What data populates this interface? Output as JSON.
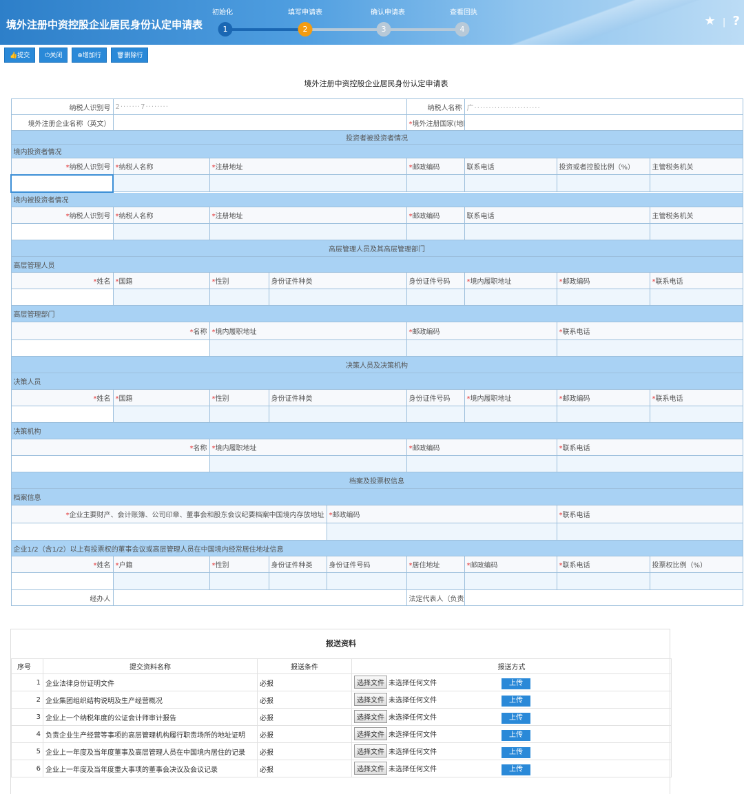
{
  "header": {
    "title": "境外注册中资控股企业居民身份认定申请表",
    "steps": [
      {
        "label": "初始化",
        "num": "1"
      },
      {
        "label": "填写申请表",
        "num": "2"
      },
      {
        "label": "确认申请表",
        "num": "3"
      },
      {
        "label": "查看回执",
        "num": "4"
      }
    ],
    "active_step": 2,
    "colors": {
      "done": "#1a67b3",
      "active": "#f39c12",
      "pending": "#b7c9d8"
    },
    "right": {
      "star": "★",
      "sep": "|",
      "help": "?"
    }
  },
  "toolbar": {
    "submit": "提交",
    "close": "关闭",
    "add_row": "增加行",
    "delete_row": "删除行"
  },
  "form": {
    "title": "境外注册中资控股企业居民身份认定申请表",
    "taxpayer_id_label": "纳税人识别号",
    "taxpayer_id_value": "2·······7········",
    "taxpayer_name_label": "纳税人名称",
    "taxpayer_name_value": "广·······················",
    "en_name_label": "境外注册企业名称（英文）",
    "country_label": "境外注册国家(地区)",
    "sec_investor": "投资者被投资者情况",
    "domestic_investor": "境内投资者情况",
    "domestic_invested": "境内被投资者情况",
    "col_taxid": "纳税人识别号",
    "col_taxname": "纳税人名称",
    "col_regaddr": "注册地址",
    "col_postcode": "邮政编码",
    "col_phone": "联系电话",
    "col_ratio": "投资或者控股比例（%）",
    "col_taxoffice": "主管税务机关",
    "sec_senior": "高层管理人员及其高层管理部门",
    "senior_staff": "高层管理人员",
    "senior_dept": "高层管理部门",
    "col_name": "姓名",
    "col_nationality": "国籍",
    "col_gender": "性别",
    "col_idtype": "身份证件种类",
    "col_idno": "身份证件号码",
    "col_dutyaddr": "境内履职地址",
    "col_deptname": "名称",
    "sec_decision": "决策人员及决策机构",
    "decision_staff": "决策人员",
    "decision_org": "决策机构",
    "sec_archive": "档案及投票权信息",
    "archive_info": "档案信息",
    "archive_addr": "企业主要财产、会计账簿、公司印章、董事会和股东会议纪要档案中国境内存放地址",
    "vote_info": "企业1/2（含1/2）以上有投票权的董事会议或高层管理人员在中国境内经常居住地址信息",
    "col_hukou": "户籍",
    "col_resaddr": "居住地址",
    "col_voteratio": "投票权比例（%）",
    "handler_label": "经办人",
    "legal_rep_label": "法定代表人（负责人）"
  },
  "submission": {
    "title": "报送资料",
    "headers": {
      "seq": "序号",
      "name": "提交资料名称",
      "cond": "报送条件",
      "method": "报送方式"
    },
    "choose_file": "选择文件",
    "no_file": "未选择任何文件",
    "upload": "上传",
    "rows": [
      {
        "seq": "1",
        "name": "企业法律身份证明文件",
        "cond": "必报"
      },
      {
        "seq": "2",
        "name": "企业集团组织结构说明及生产经营概况",
        "cond": "必报"
      },
      {
        "seq": "3",
        "name": "企业上一个纳税年度的公证会计师审计报告",
        "cond": "必报"
      },
      {
        "seq": "4",
        "name": "负责企业生产经营等事项的高层管理机构履行职责场所的地址证明",
        "cond": "必报"
      },
      {
        "seq": "5",
        "name": "企业上一年度及当年度董事及高层管理人员在中国境内居住的记录",
        "cond": "必报"
      },
      {
        "seq": "6",
        "name": "企业上一年度及当年度重大事项的董事会决议及会议记录",
        "cond": "必报"
      }
    ]
  }
}
